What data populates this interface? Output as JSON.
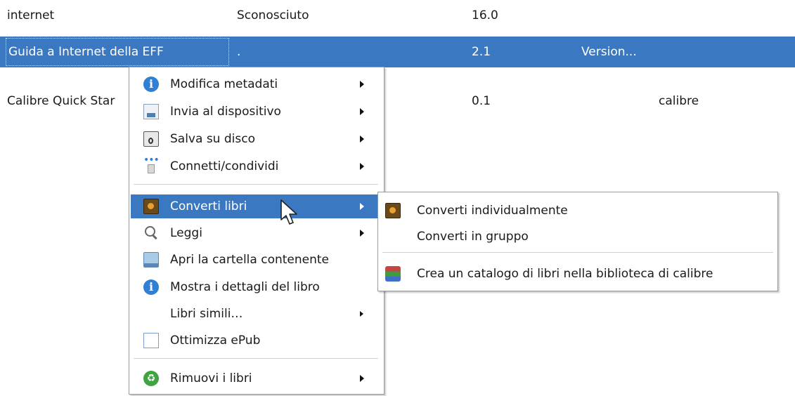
{
  "library": {
    "rows": [
      {
        "title": "internet",
        "author": "Sconosciuto",
        "size": "16.0",
        "series": "",
        "tag": ""
      },
      {
        "title": "Guida a Internet della EFF",
        "author": ".",
        "size": "2.1",
        "series": "Version...",
        "tag": ""
      },
      {
        "title": "Calibre Quick Star",
        "author": "",
        "size": "0.1",
        "series": "",
        "tag": "calibre"
      }
    ]
  },
  "context_menu": {
    "items": [
      {
        "label": "Modifica metadati",
        "icon": "info-icon"
      },
      {
        "label": "Invia al dispositivo",
        "icon": "device-icon"
      },
      {
        "label": "Salva su disco",
        "icon": "save-icon"
      },
      {
        "label": "Connetti/condividi",
        "icon": "connect-icon"
      },
      {
        "label": "Converti libri",
        "icon": "convert-book-icon"
      },
      {
        "label": "Leggi",
        "icon": "search-icon"
      },
      {
        "label": "Apri la cartella contenente",
        "icon": "folder-icon"
      },
      {
        "label": "Mostra i dettagli del libro",
        "icon": "info-icon"
      },
      {
        "label": "Libri simili…",
        "icon": ""
      },
      {
        "label": "Ottimizza ePub",
        "icon": "epub-icon"
      },
      {
        "label": "Rimuovi i libri",
        "icon": "recycle-icon"
      }
    ]
  },
  "submenu": {
    "items": [
      {
        "label": "Converti individualmente",
        "icon": "convert-book-icon"
      },
      {
        "label": "Converti in gruppo",
        "icon": ""
      },
      {
        "label": "Crea un catalogo di libri nella biblioteca di calibre",
        "icon": "catalog-icon"
      }
    ]
  },
  "colors": {
    "selection": "#3b78c2",
    "menu_border": "#9a9a9a",
    "separator": "#d0d0d0"
  }
}
